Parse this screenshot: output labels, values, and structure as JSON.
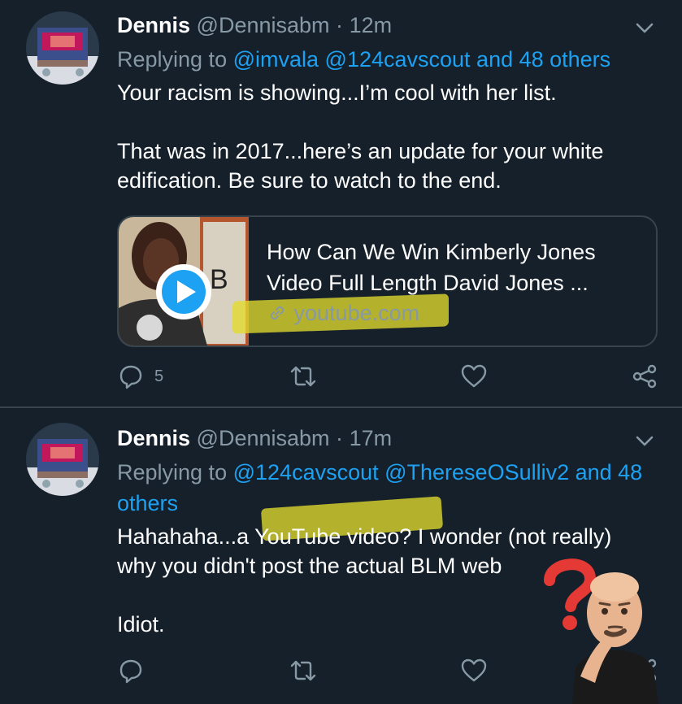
{
  "tweets": [
    {
      "display_name": "Dennis",
      "handle": "@Dennisabm",
      "separator": "·",
      "time": "12m",
      "replying_label": "Replying to",
      "replying_to": "@imvala @124cavscout and 48 others",
      "text": "Your racism is showing...I’m cool with her list.\n\nThat was in 2017...here’s an update for your white edification. Be sure to watch to the end.",
      "card": {
        "title": "How Can We Win Kimberly Jones Video Full Length David Jones ...",
        "domain": "youtube.com"
      },
      "reply_count": "5"
    },
    {
      "display_name": "Dennis",
      "handle": "@Dennisabm",
      "separator": "·",
      "time": "17m",
      "replying_label": "Replying to",
      "replying_to": "@124cavscout @ThereseOSulliv2 and 48 others",
      "text": "Hahahaha...a YouTube video?  I wonder (not really) why you didn't post the actual BLM web\n\nIdiot.",
      "reply_count": ""
    }
  ],
  "colors": {
    "background": "#15202b",
    "link": "#1da1f2",
    "muted": "#8899a6",
    "divider": "#38444d",
    "highlight": "#e2db2d",
    "question_mark": "#e53935"
  },
  "icons": [
    "chevron-down-icon",
    "reply-icon",
    "retweet-icon",
    "like-icon",
    "share-icon",
    "play-icon",
    "link-icon",
    "question-mark-icon"
  ]
}
